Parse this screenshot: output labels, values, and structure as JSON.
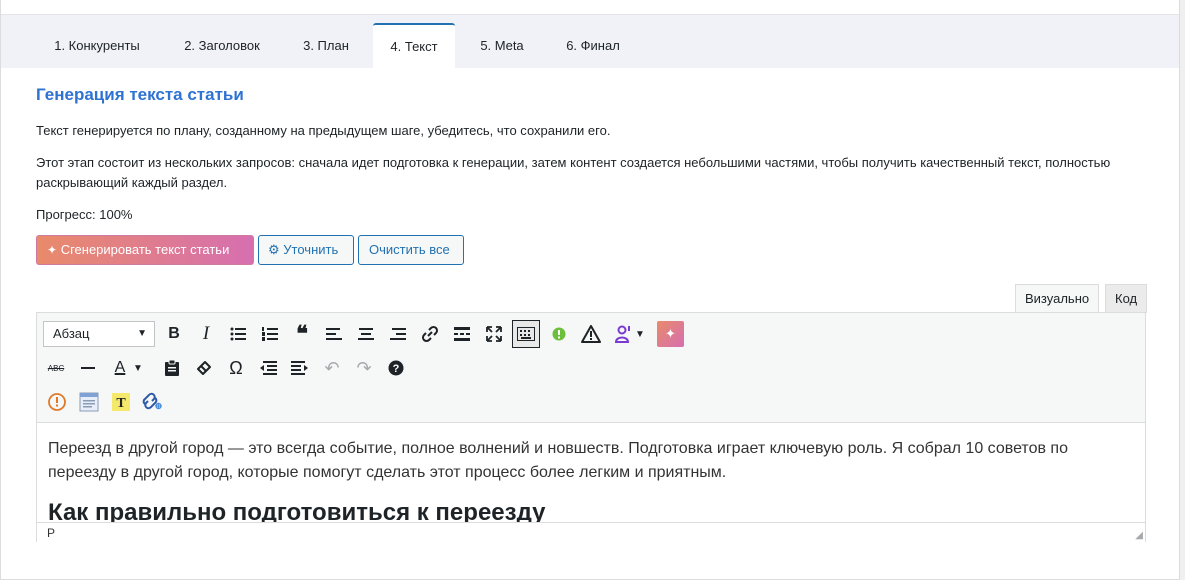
{
  "tabs": [
    {
      "label": "1. Конкуренты"
    },
    {
      "label": "2. Заголовок"
    },
    {
      "label": "3. План"
    },
    {
      "label": "4. Текст"
    },
    {
      "label": "5. Meta"
    },
    {
      "label": "6. Финал"
    }
  ],
  "active_tab": "4. Текст",
  "section": {
    "title": "Генерация текста статьи",
    "note": "Текст генерируется по плану, созданному на предыдущем шаге, убедитесь, что сохранили его.",
    "description": "Этот этап состоит из нескольких запросов: сначала идет подготовка к генерации, затем контент создается небольшими частями, чтобы получить качественный текст, полностью раскрывающий каждый раздел.",
    "progress_label": "Прогресс: 100%",
    "progress_value": 100
  },
  "buttons": {
    "generate": "Сгенерировать текст статьи",
    "refine": "Уточнить",
    "clear": "Очистить все"
  },
  "editor": {
    "mode_visual": "Визуально",
    "mode_code": "Код",
    "format_select": "Абзац",
    "paragraph": "Переезд в другой город — это всегда событие, полное волнений и новшеств. Подготовка играет ключевую роль. Я собрал 10 советов по переезду в другой город, которые помогут сделать этот процесс более легким и приятным.",
    "heading": "Как правильно подготовиться к переезду",
    "status_path": "P"
  },
  "colors": {
    "accent": "#2271b1",
    "title": "#2e72d2",
    "gradient_start": "#e98a6a",
    "gradient_end": "#d66fb0"
  }
}
